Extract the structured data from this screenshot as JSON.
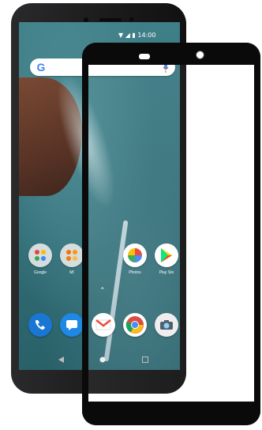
{
  "image": {
    "brand_colors": {
      "phone_body": "#1f1f21",
      "protector_frame": "#0a0a0a",
      "wallpaper_sea": "#3f7f88",
      "wallpaper_land": "#6b3e2c"
    }
  },
  "phone": {
    "status_bar": {
      "time": "14:00"
    },
    "search": {
      "logo_letter": "G"
    },
    "apps": [
      {
        "name": "google-folder-icon",
        "label": "Google"
      },
      {
        "name": "mi-folder-icon",
        "label": "MI"
      },
      {
        "name": "photos-icon",
        "label": "Photos"
      },
      {
        "name": "play-store-icon",
        "label": "Play Sto"
      }
    ],
    "dock": [
      {
        "name": "phone-app-icon"
      },
      {
        "name": "messages-icon"
      },
      {
        "name": "gmail-icon"
      },
      {
        "name": "chrome-icon"
      },
      {
        "name": "camera-icon"
      }
    ],
    "nav": [
      "back-icon",
      "home-icon",
      "recents-icon"
    ]
  }
}
